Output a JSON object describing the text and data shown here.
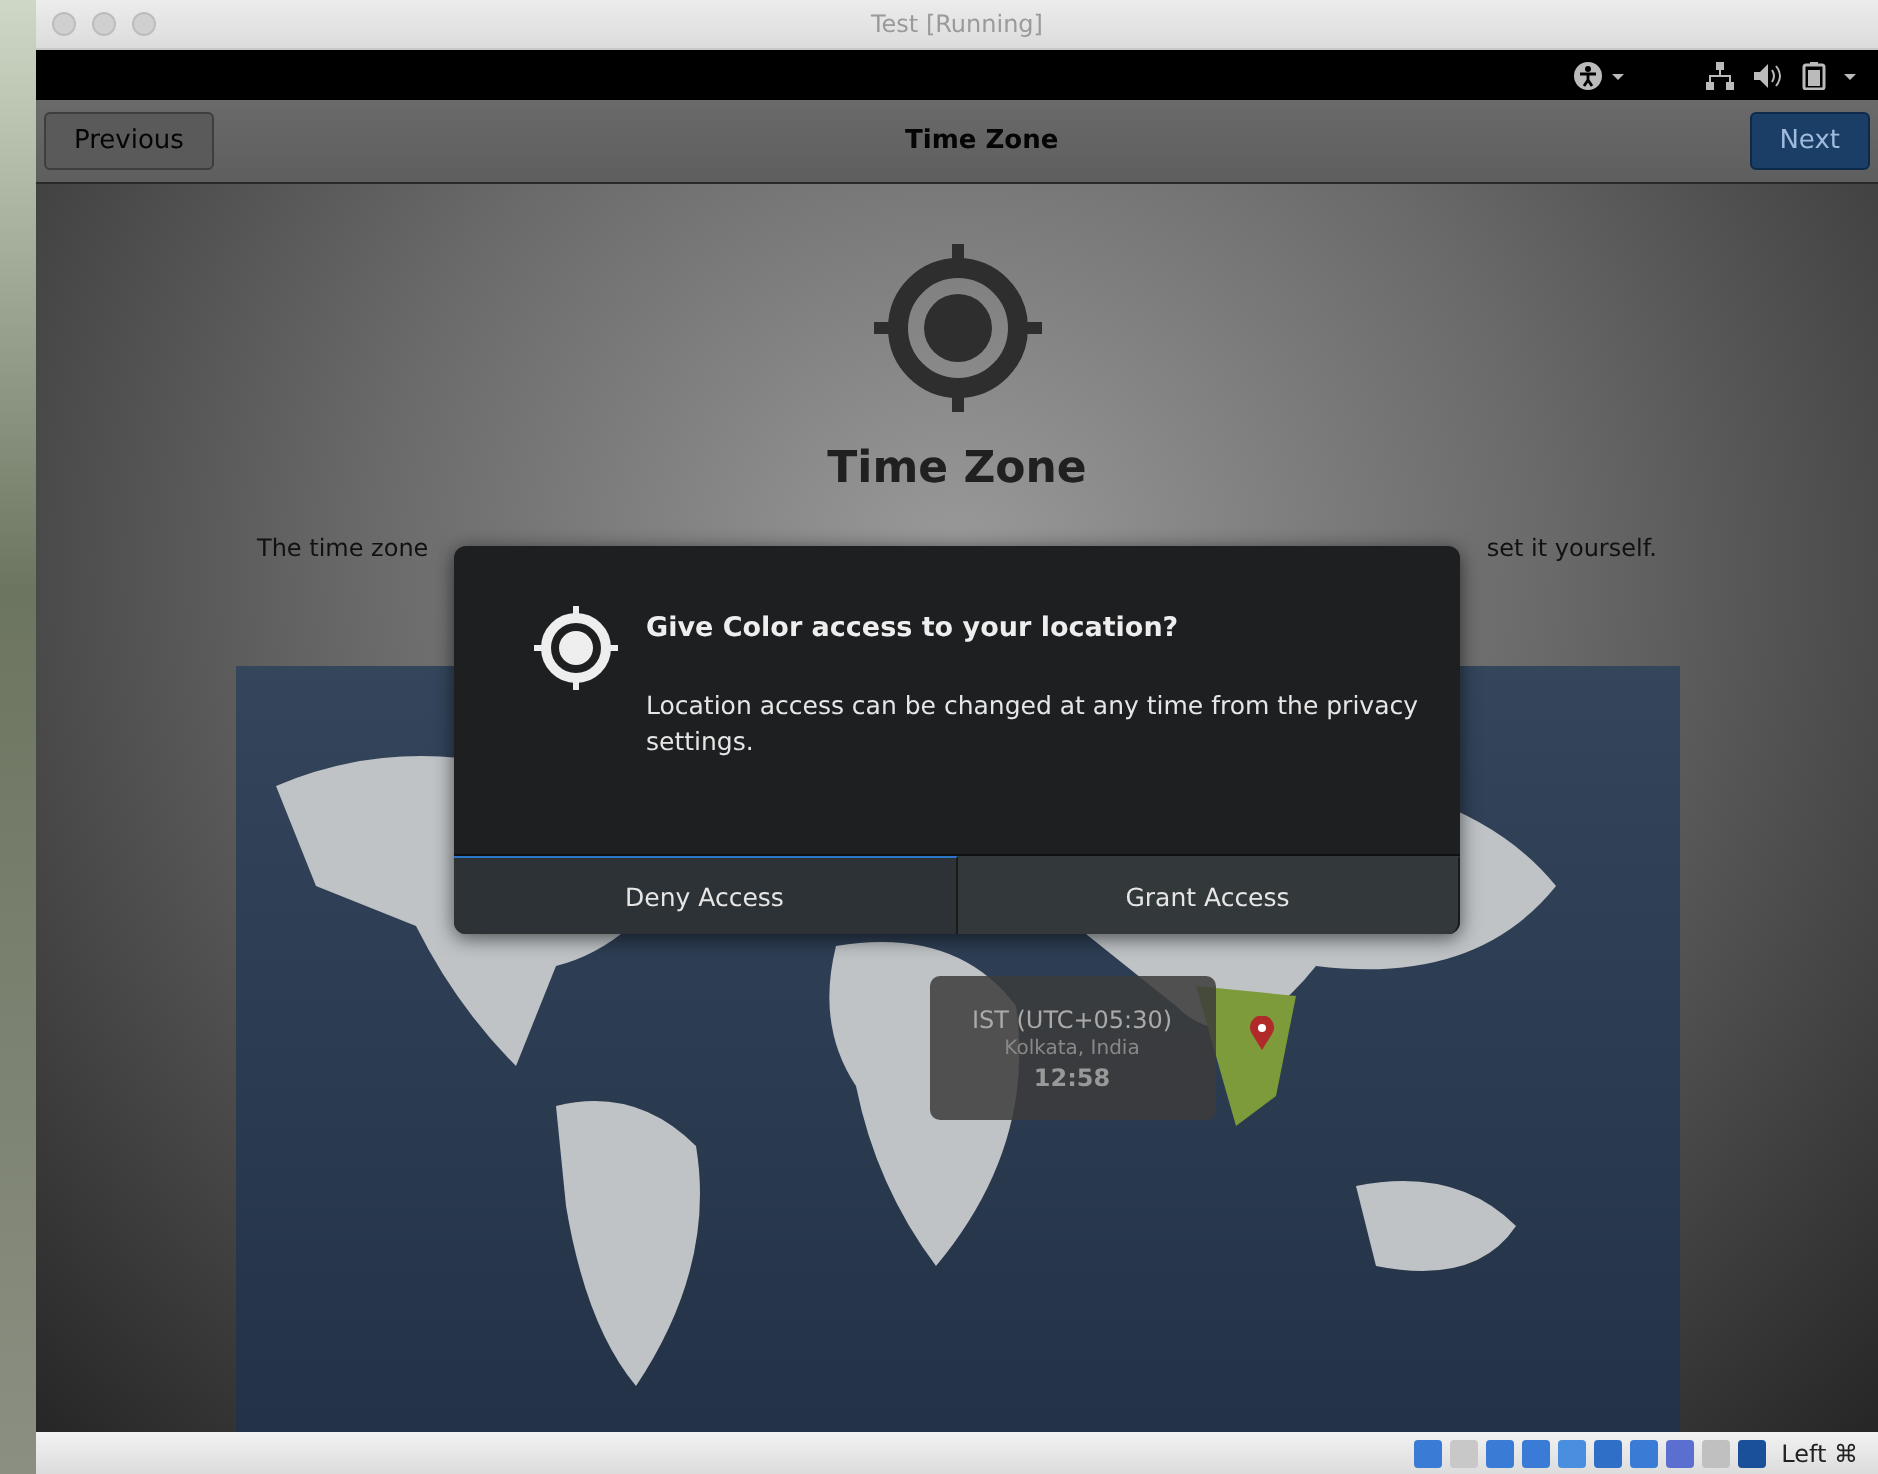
{
  "host_window": {
    "title": "Test [Running]"
  },
  "header": {
    "previous": "Previous",
    "title": "Time Zone",
    "next": "Next"
  },
  "page": {
    "heading": "Time Zone",
    "description_start": "The time zone",
    "description_end": "set it yourself."
  },
  "timezone_popup": {
    "zone": "IST (UTC+05:30)",
    "city": "Kolkata, India",
    "time": "12:58"
  },
  "dialog": {
    "title": "Give Color access to your location?",
    "message": "Location access can be changed at any time from the privacy settings.",
    "buttons": [
      {
        "label": "Deny Access",
        "selected": true
      },
      {
        "label": "Grant Access",
        "selected": false
      }
    ]
  },
  "status_bar": {
    "host_key": "Left ⌘"
  }
}
